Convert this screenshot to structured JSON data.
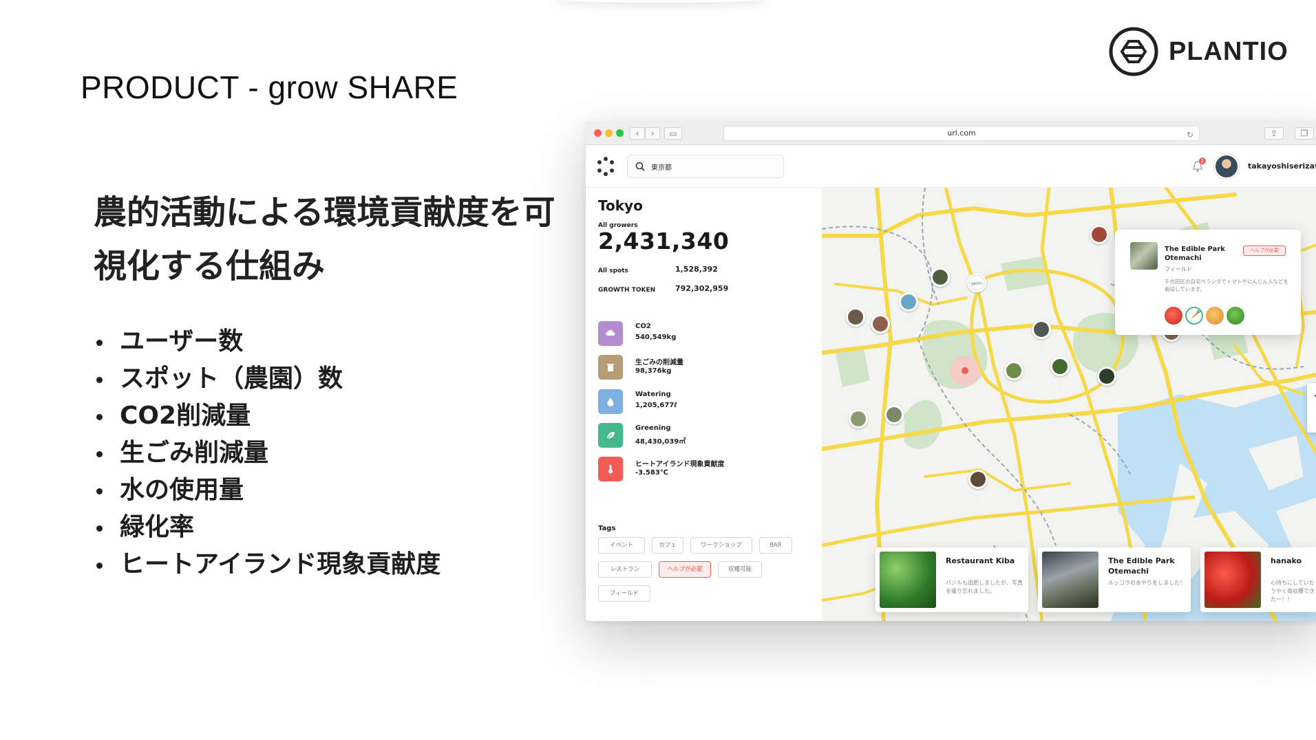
{
  "slide": {
    "title": "PRODUCT - grow SHARE",
    "brand": "PLANTIO",
    "headline": "農的活動による環境貢献度を可視化する仕組み",
    "bullets": [
      "ユーザー数",
      "スポット（農園）数",
      "CO2削減量",
      "生ごみ削減量",
      "水の使用量",
      "緑化率",
      "ヒートアイランド現象貢献度"
    ]
  },
  "browser": {
    "url": "url.com",
    "search_query": "東京都",
    "notification_count": "2",
    "username": "takayoshiserizawa"
  },
  "panel": {
    "city": "Tokyo",
    "all_growers_label": "All growers",
    "all_growers_value": "2,431,340",
    "all_spots_label": "All spots",
    "all_spots_value": "1,528,392",
    "growth_token_label": "GROWTH TOKEN",
    "growth_token_value": "792,302,959",
    "metrics": [
      {
        "name": "CO2",
        "value": "540,549kg",
        "color": "#b48ccf",
        "icon": "cloud-icon"
      },
      {
        "name": "生ごみの削減量",
        "value": "98,376kg",
        "color": "#b59c74",
        "icon": "trash-icon"
      },
      {
        "name": "Watering",
        "value": "1,205,677ℓ",
        "color": "#7bb0e0",
        "icon": "water-drop-icon"
      },
      {
        "name": "Greening",
        "value": "48,430,039㎡",
        "color": "#43b88a",
        "icon": "leaf-icon"
      },
      {
        "name": "ヒートアイランド現象貢献度",
        "value": "-3.583℃",
        "color": "#f25c54",
        "icon": "thermometer-icon"
      }
    ],
    "tags_label": "Tags",
    "tags": [
      "イベント",
      "カフェ",
      "ワークショップ",
      "BAR",
      "レストラン",
      "ヘルプが必要",
      "収穫可能",
      "フィールド"
    ]
  },
  "popup": {
    "title": "The Edible Park Otemachi",
    "badge": "ヘルプが必要",
    "category": "フィールド",
    "description": "千代田区の自宅ベランダでトマトやにんじん人などを栽培しています。"
  },
  "map": {
    "germ_label": "germ"
  },
  "cards": [
    {
      "title": "Restaurant Kiba",
      "desc": "バジルも追肥しましたが、写真を撮り忘れました。"
    },
    {
      "title": "The Edible Park Otemachi",
      "desc": "ルッコラの水やりをしました！"
    },
    {
      "title": "hanako",
      "desc": "心待ちにしていたうやく苺収穫できたー！！"
    }
  ],
  "colors": {
    "accent": "#f25c54",
    "road": "#f5d94a",
    "water": "#bfe0f5",
    "park": "#cfe4c8"
  }
}
